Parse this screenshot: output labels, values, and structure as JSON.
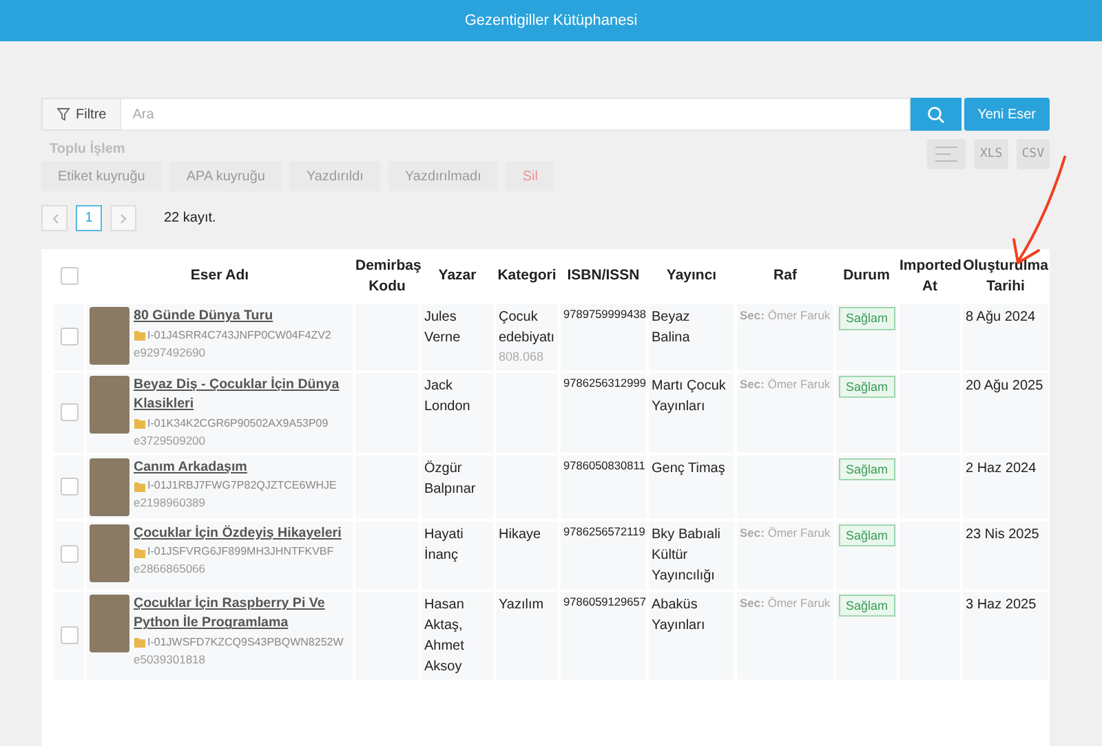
{
  "app_bar": {
    "title": "Gezentigiller Kütüphanesi"
  },
  "toolbar": {
    "filter_label": "Filtre",
    "search_placeholder": "Ara",
    "new_button": "Yeni Eser"
  },
  "bulk_actions": {
    "label": "Toplu İşlem",
    "disabled": true,
    "buttons": [
      {
        "label": "Etiket kuyruğu",
        "kind": "normal"
      },
      {
        "label": "APA kuyruğu",
        "kind": "normal"
      },
      {
        "label": "Yazdırıldı",
        "kind": "normal"
      },
      {
        "label": "Yazdırılmadı",
        "kind": "normal"
      },
      {
        "label": "Sil",
        "kind": "danger"
      }
    ]
  },
  "export_buttons": [
    "XLS",
    "CSV"
  ],
  "pagination": {
    "pages": [
      {
        "label": "1",
        "selected": true
      }
    ],
    "count": "22 kayıt."
  },
  "table": {
    "select_all_checked": false,
    "columns": [
      "Eser Adı",
      "Demirbaş Kodu",
      "Yazar",
      "Kategori",
      "ISBN/ISSN",
      "Yayıncı",
      "Raf",
      "Durum",
      "Imported At",
      "Oluşturulma Tarihi"
    ],
    "rows": [
      {
        "checked": false,
        "title": "80 Günde Dünya Turu",
        "code": "I-01J4SRR4C743JNFP0CW04F4ZV2",
        "barcode": "e9297492690",
        "author": "Jules Verne",
        "category": "Çocuk edebiyatı",
        "category_code": "808.068",
        "isbn": "9789759999438",
        "publisher": "Beyaz Balina",
        "shelf": "**Sec:** Ömer Faruk",
        "status": "Sağlam",
        "created": "8 Ağu 2024"
      },
      {
        "checked": false,
        "title": "Beyaz Diş - Çocuklar İçin Dünya Klasikleri",
        "code": "I-01K34K2CGR6P90502AX9A53P09",
        "barcode": "e3729509200",
        "author": "Jack London",
        "isbn": "9786256312999",
        "publisher": "Martı Çocuk Yayınları",
        "shelf": "**Sec:** Ömer Faruk",
        "status": "Sağlam",
        "created": "20 Ağu 2025"
      },
      {
        "checked": false,
        "title": "Canım Arkadaşım",
        "code": "I-01J1RBJ7FWG7P82QJZTCE6WHJE",
        "barcode": "e2198960389",
        "author": "Özgür Balpınar",
        "isbn": "9786050830811",
        "publisher": "Genç Timaş",
        "status": "Sağlam",
        "created": "2 Haz 2024"
      },
      {
        "checked": false,
        "title": "Çocuklar İçin Özdeyiş Hikayeleri",
        "code": "I-01JSFVRG6JF899MH3JHNTFKVBF",
        "barcode": "e2866865066",
        "author": "Hayati İnanç",
        "category": "Hikaye",
        "isbn": "9786256572119",
        "publisher": "Bky Babıali Kültür Yayıncılığı",
        "shelf": "**Sec:** Ömer Faruk",
        "status": "Sağlam",
        "created": "23 Nis 2025"
      },
      {
        "checked": false,
        "title": "Çocuklar İçin Raspberry Pi Ve Python İle Programlama",
        "code": "I-01JWSFD7KZCQ9S43PBQWN8252W",
        "barcode": "e5039301818",
        "author": "Hasan Aktaş, Ahmet Aksoy",
        "category": "Yazılım",
        "isbn": "9786059129657",
        "publisher": "Abaküs Yayınları",
        "shelf": "**Sec:** Ömer Faruk",
        "status": "Sağlam",
        "created": "3 Haz 2025"
      }
    ]
  }
}
